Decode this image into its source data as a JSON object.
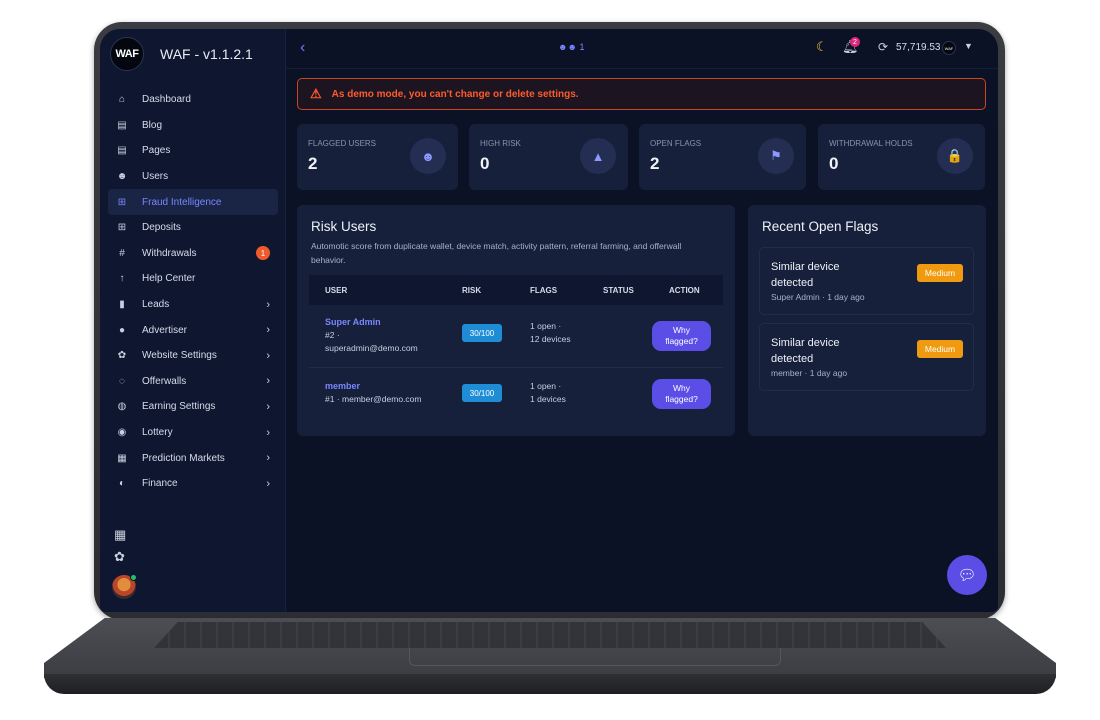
{
  "app": {
    "logo_text": "WAF",
    "title": "WAF - v1.1.2.1"
  },
  "sidebar": {
    "items": [
      {
        "label": "Dashboard",
        "icon": "home-icon",
        "glyph": "⌂",
        "arrow": "",
        "badge": ""
      },
      {
        "label": "Blog",
        "icon": "blog-icon",
        "glyph": "▤",
        "arrow": "",
        "badge": ""
      },
      {
        "label": "Pages",
        "icon": "pages-icon",
        "glyph": "▤",
        "arrow": "",
        "badge": ""
      },
      {
        "label": "Users",
        "icon": "users-icon",
        "glyph": "☻",
        "arrow": "",
        "badge": ""
      },
      {
        "label": "Fraud Intelligence",
        "icon": "fraud-icon",
        "glyph": "⊞",
        "arrow": "",
        "badge": "",
        "active": true
      },
      {
        "label": "Deposits",
        "icon": "deposits-icon",
        "glyph": "⊞",
        "arrow": "",
        "badge": ""
      },
      {
        "label": "Withdrawals",
        "icon": "withdrawals-icon",
        "glyph": "#",
        "arrow": "",
        "badge": "1"
      },
      {
        "label": "Help Center",
        "icon": "help-icon",
        "glyph": "↑",
        "arrow": "",
        "badge": ""
      },
      {
        "label": "Leads",
        "icon": "leads-icon",
        "glyph": "▮",
        "arrow": "›",
        "badge": ""
      },
      {
        "label": "Advertiser",
        "icon": "advertiser-icon",
        "glyph": "●",
        "arrow": "›",
        "badge": ""
      },
      {
        "label": "Website Settings",
        "icon": "settings-icon",
        "glyph": "✿",
        "arrow": "›",
        "badge": ""
      },
      {
        "label": "Offerwalls",
        "icon": "offerwalls-icon",
        "glyph": "◌",
        "arrow": "›",
        "badge": ""
      },
      {
        "label": "Earning Settings",
        "icon": "earning-icon",
        "glyph": "◍",
        "arrow": "›",
        "badge": ""
      },
      {
        "label": "Lottery",
        "icon": "lottery-icon",
        "glyph": "◉",
        "arrow": "›",
        "badge": ""
      },
      {
        "label": "Prediction Markets",
        "icon": "prediction-icon",
        "glyph": "▦",
        "arrow": "›",
        "badge": ""
      },
      {
        "label": "Finance",
        "icon": "finance-icon",
        "glyph": "◐",
        "arrow": "›",
        "badge": ""
      }
    ]
  },
  "topbar": {
    "online_count": "1",
    "notification_count": "2",
    "balance": "57,719.53",
    "coin_text": "WAF"
  },
  "alert": {
    "message": "As demo mode, you can't change or delete settings."
  },
  "stats": [
    {
      "label": "FLAGGED USERS",
      "value": "2",
      "icon": "user-cog-icon",
      "glyph": "☻"
    },
    {
      "label": "HIGH RISK",
      "value": "0",
      "icon": "warning-icon",
      "glyph": "▲"
    },
    {
      "label": "OPEN FLAGS",
      "value": "2",
      "icon": "flag-icon",
      "glyph": "⚑"
    },
    {
      "label": "WITHDRAWAL HOLDS",
      "value": "0",
      "icon": "lock-icon",
      "glyph": "🔒"
    }
  ],
  "risk_users": {
    "title": "Risk Users",
    "description": "Automotic score from duplicate wallet, device match, activity pattern, referral farming, and offerwall behavior.",
    "headers": [
      "USER",
      "RISK",
      "FLAGS",
      "STATUS",
      "ACTION"
    ],
    "rows": [
      {
        "name": "Super Admin",
        "id_line": "#2 ·",
        "email_line": "superadmin@demo.com",
        "risk": "30/100",
        "flags_line1": "1 open ·",
        "flags_line2": "12 devices",
        "status": "",
        "action_line1": "Why",
        "action_line2": "flagged?"
      },
      {
        "name": "member",
        "id_line": "#1 · member@demo.com",
        "email_line": "",
        "risk": "30/100",
        "flags_line1": "1 open ·",
        "flags_line2": "1 devices",
        "status": "",
        "action_line1": "Why",
        "action_line2": "flagged?"
      }
    ]
  },
  "recent_flags": {
    "title": "Recent Open Flags",
    "items": [
      {
        "title_line1": "Similar device",
        "title_line2": "detected",
        "meta": "Super Admin · 1 day ago",
        "severity": "Medium"
      },
      {
        "title_line1": "Similar device",
        "title_line2": "detected",
        "meta": "member · 1 day ago",
        "severity": "Medium"
      }
    ]
  },
  "colors": {
    "accent": "#5b4ee6",
    "alert": "#ff5a2c",
    "medium": "#f09a0f",
    "risk_badge": "#1f8dd6",
    "background": "#0b1226"
  }
}
